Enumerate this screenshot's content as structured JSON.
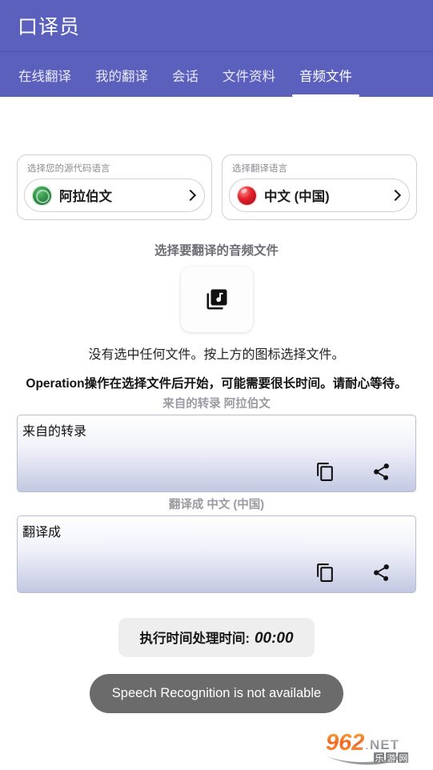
{
  "app": {
    "title": "口译员",
    "accent_color": "#5b60bd"
  },
  "tabs": [
    {
      "label": "在线翻译",
      "active": false
    },
    {
      "label": "我的翻译",
      "active": false
    },
    {
      "label": "会话",
      "active": false
    },
    {
      "label": "文件资料",
      "active": false
    },
    {
      "label": "音频文件",
      "active": true
    }
  ],
  "source_language": {
    "label": "选择您的源代码语言",
    "value": "阿拉伯文",
    "flag_color": "#2f9146",
    "flag_icon": "arabic-flag-icon",
    "chevron": "chevron-right-icon"
  },
  "target_language": {
    "label": "选择翻译语言",
    "value": "中文 (中国)",
    "flag_color": "#e2202a",
    "flag_icon": "china-flag-icon",
    "chevron": "chevron-right-icon"
  },
  "picker": {
    "title": "选择要翻译的音频文件",
    "icon": "library-music-icon",
    "no_file_text": "没有选中任何文件。按上方的图标选择文件。",
    "warning_text": "Operation操作在选择文件后开始，可能需要很长时间。请耐心等待。"
  },
  "transcription": {
    "label": "来自的转录 阿拉伯文",
    "value": "来自的转录",
    "copy_icon": "copy-icon",
    "share_icon": "share-icon"
  },
  "translation": {
    "label": "翻译成 中文 (中国)",
    "value": "翻译成",
    "copy_icon": "copy-icon",
    "share_icon": "share-icon"
  },
  "footer": {
    "timer_label": "执行时间处理时间:",
    "timer_value": "00:00",
    "status_text": "Speech Recognition is not available",
    "status_bg": "#6b6b6b"
  },
  "watermark": {
    "number": "962",
    "net": ".NET",
    "cn": "乐游网"
  }
}
